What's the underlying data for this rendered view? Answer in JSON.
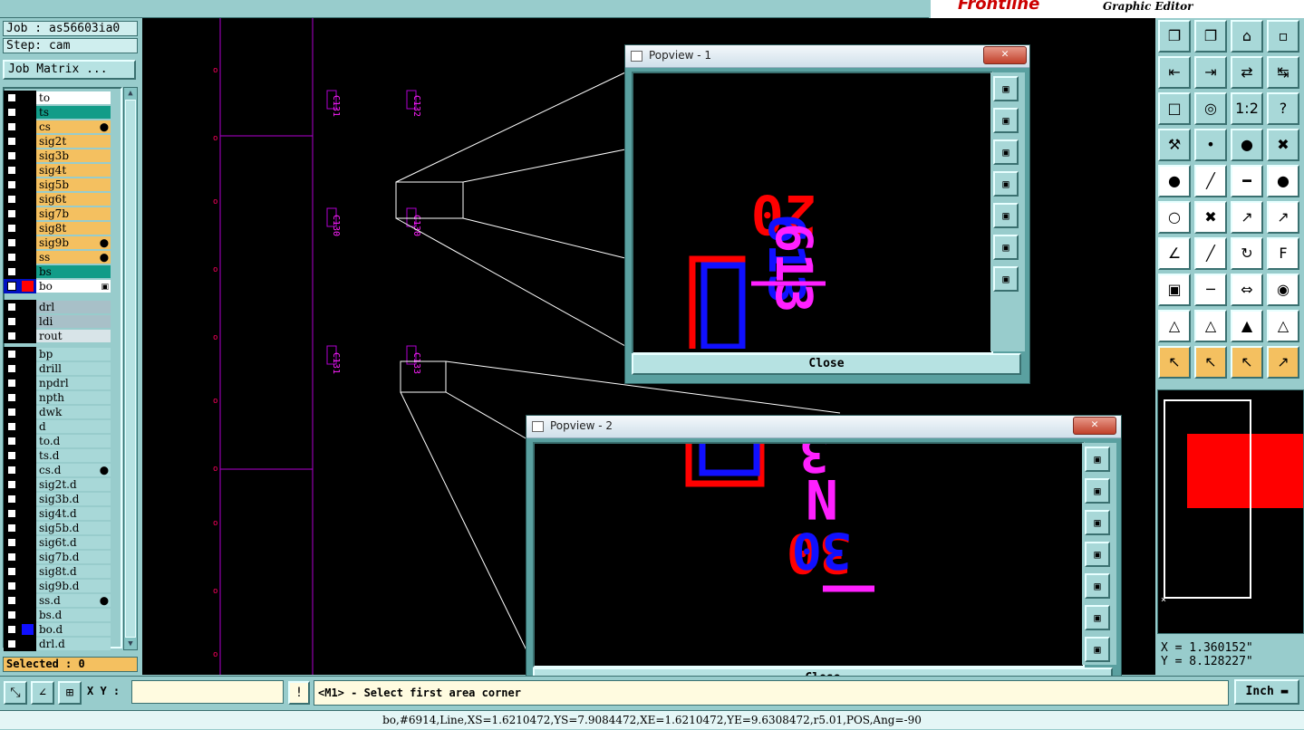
{
  "app": {
    "brand": "Frontline",
    "subtitle": "Graphic Editor"
  },
  "left": {
    "job": "Job : as56603ia0",
    "step": "Step: cam",
    "job_matrix": "Job Matrix ...",
    "selected": "Selected : 0",
    "layers_board": [
      {
        "name": "to",
        "bg": "#ffffff"
      },
      {
        "name": "ts",
        "bg": "#129c88"
      },
      {
        "name": "cs",
        "bg": "#f4c060",
        "mark": "⬤"
      },
      {
        "name": "sig2t",
        "bg": "#f4c060"
      },
      {
        "name": "sig3b",
        "bg": "#f4c060"
      },
      {
        "name": "sig4t",
        "bg": "#f4c060"
      },
      {
        "name": "sig5b",
        "bg": "#f4c060"
      },
      {
        "name": "sig6t",
        "bg": "#f4c060"
      },
      {
        "name": "sig7b",
        "bg": "#f4c060"
      },
      {
        "name": "sig8t",
        "bg": "#f4c060"
      },
      {
        "name": "sig9b",
        "bg": "#f4c060",
        "mark": "⬤"
      },
      {
        "name": "ss",
        "bg": "#f4c060",
        "mark": "⬤"
      },
      {
        "name": "bs",
        "bg": "#129c88"
      },
      {
        "name": "bo",
        "bg": "#ffffff",
        "active": true,
        "color": "#ff0000",
        "mark": "▣"
      }
    ],
    "layers_drill": [
      {
        "name": "drl",
        "bg": "#a8c0c8"
      },
      {
        "name": "ldi",
        "bg": "#a8c0c8"
      },
      {
        "name": "rout",
        "bg": "#d8e4e8"
      }
    ],
    "layers_misc": [
      {
        "name": "bp",
        "bg": "#a8d8d8"
      },
      {
        "name": "drill",
        "bg": "#a8d8d8"
      },
      {
        "name": "npdrl",
        "bg": "#a8d8d8"
      },
      {
        "name": "npth",
        "bg": "#a8d8d8"
      },
      {
        "name": "dwk",
        "bg": "#a8d8d8"
      },
      {
        "name": "d",
        "bg": "#a8d8d8"
      },
      {
        "name": "to.d",
        "bg": "#a8d8d8"
      },
      {
        "name": "ts.d",
        "bg": "#a8d8d8"
      },
      {
        "name": "cs.d",
        "bg": "#a8d8d8",
        "mark": "⬤"
      },
      {
        "name": "sig2t.d",
        "bg": "#a8d8d8"
      },
      {
        "name": "sig3b.d",
        "bg": "#a8d8d8"
      },
      {
        "name": "sig4t.d",
        "bg": "#a8d8d8"
      },
      {
        "name": "sig5b.d",
        "bg": "#a8d8d8"
      },
      {
        "name": "sig6t.d",
        "bg": "#a8d8d8"
      },
      {
        "name": "sig7b.d",
        "bg": "#a8d8d8"
      },
      {
        "name": "sig8t.d",
        "bg": "#a8d8d8"
      },
      {
        "name": "sig9b.d",
        "bg": "#a8d8d8"
      },
      {
        "name": "ss.d",
        "bg": "#a8d8d8",
        "mark": "⬤"
      },
      {
        "name": "bs.d",
        "bg": "#a8d8d8"
      },
      {
        "name": "bo.d",
        "bg": "#a8d8d8",
        "color": "#1010ff"
      },
      {
        "name": "drl.d",
        "bg": "#a8d8d8"
      }
    ]
  },
  "popview1": {
    "title": "Popview - 1",
    "close": "Close",
    "x": "✕"
  },
  "popview2": {
    "title": "Popview - 2",
    "close": "Close",
    "x": "✕"
  },
  "coords": {
    "x": "X = 1.360152\"",
    "y": "Y = 8.128227\""
  },
  "bottom": {
    "xy_label": "X Y :",
    "xy_value": "",
    "message": "<M1> - Select first area corner",
    "unit": "Inch",
    "status": "bo,#6914,Line,XS=1.6210472,YS=7.9084472,XE=1.6210472,YE=9.6308472,r5.01,POS,Ang=-90"
  },
  "canvas_labels": {
    "c130": "C130",
    "c131": "C131",
    "c132": "C132",
    "c133": "C133"
  },
  "colors": {
    "layer_active": "#ff0000",
    "layer_other": "#ff00ff",
    "bg": "#000000",
    "panel": "#98cccc"
  },
  "toolbar_icons": [
    "zoom-home-icon",
    "zoom-previous-icon",
    "zoom-fit-icon",
    "window-split-icon",
    "pan-left-icon",
    "pan-right-icon",
    "pan-flip-icon",
    "pan-wrap-icon",
    "zoom-area-icon",
    "zoom-center-icon",
    "zoom-one-to-one-icon",
    "help-icon",
    "snap-settings-icon",
    "tool-probe-icon",
    "display-red-icon",
    "display-cross-icon",
    "feature-select-icon",
    "line-draw-icon",
    "ruler-icon",
    "circle-pad-icon",
    "net-icon",
    "cross-icon",
    "move-icon",
    "move-red-icon",
    "angle-icon",
    "slash-icon",
    "rotate-icon",
    "text-flip-icon",
    "pad-add-icon",
    "line-cut-icon",
    "measure-icon",
    "shapes-icon",
    "triangle-icon",
    "triangle-red-icon",
    "triangle-fill-icon",
    "triangle-hatch-icon",
    "pointer-icon",
    "pointer-select-icon",
    "pointer-rotate-icon",
    "pointer-net-icon"
  ],
  "toolbar_glyphs": [
    "❐",
    "❐",
    "⌂",
    "▫",
    "⇤",
    "⇥",
    "⇄",
    "↹",
    "□",
    "◎",
    "1:2",
    "?",
    "⚒",
    "•",
    "●",
    "✖",
    "●",
    "╱",
    "━",
    "●",
    "○",
    "✖",
    "↗",
    "↗",
    "∠",
    "╱",
    "↻",
    "F",
    "▣",
    "─",
    "⇔",
    "◉",
    "△",
    "△",
    "▲",
    "△",
    "↖",
    "↖",
    "↖",
    "↗"
  ]
}
